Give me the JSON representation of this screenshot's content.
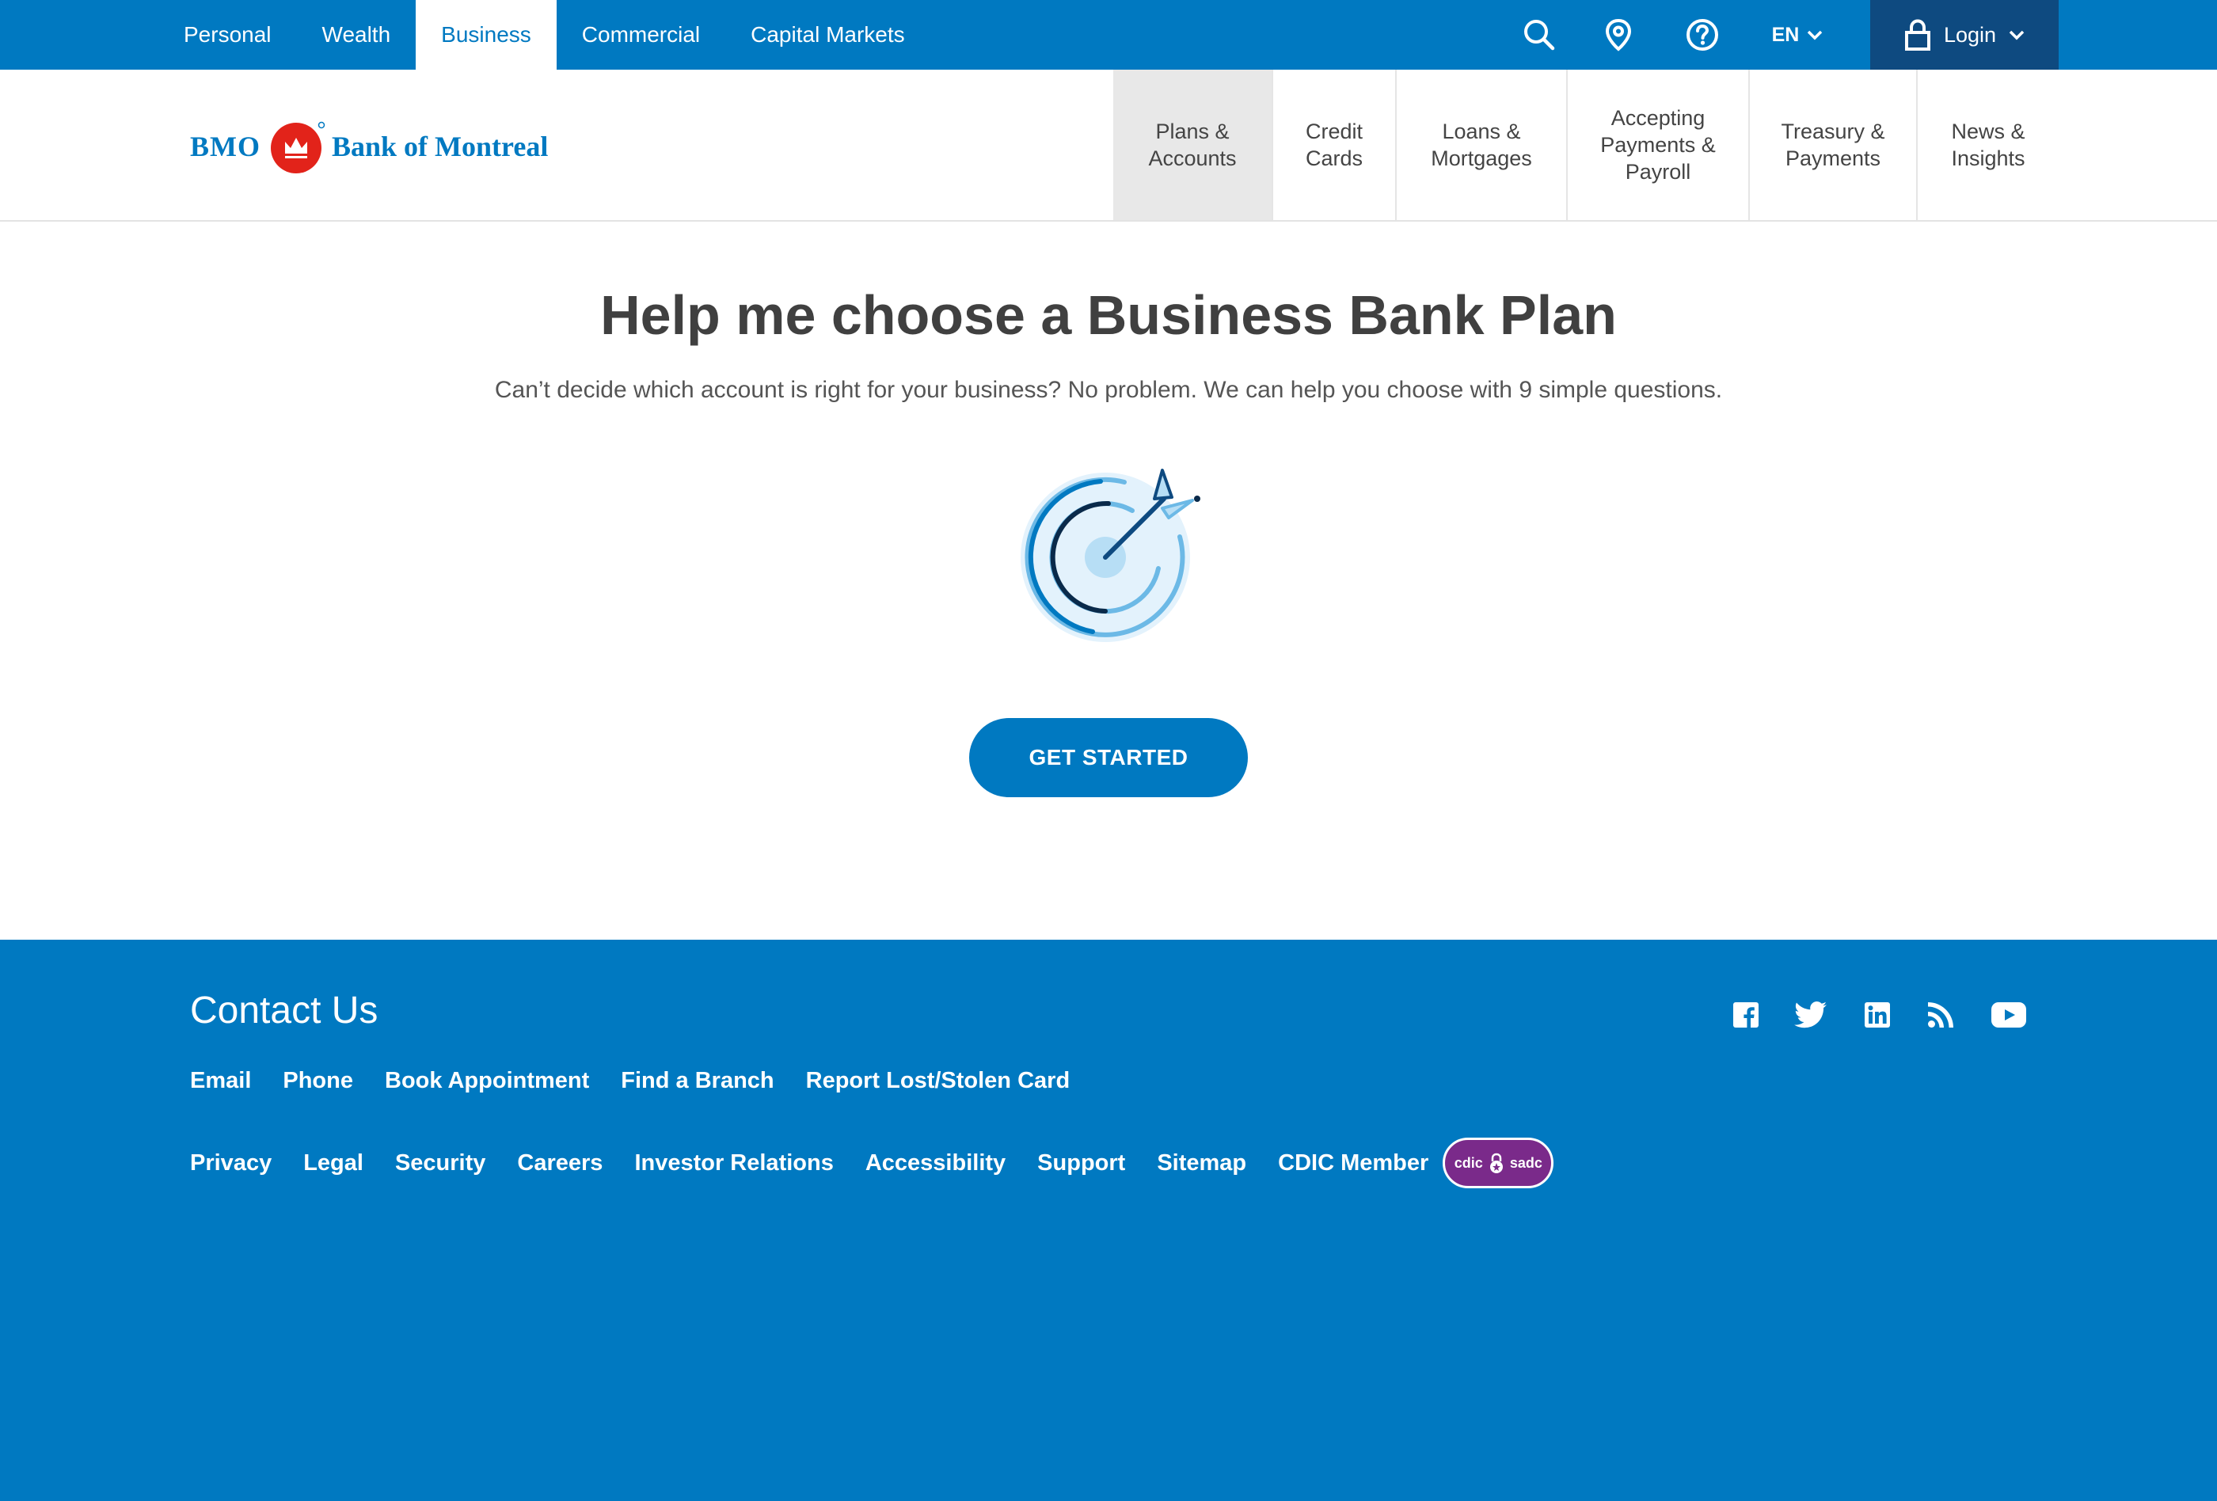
{
  "top_nav": {
    "items": [
      {
        "label": "Personal"
      },
      {
        "label": "Wealth"
      },
      {
        "label": "Business"
      },
      {
        "label": "Commercial"
      },
      {
        "label": "Capital Markets"
      }
    ],
    "active": "Business",
    "language": "EN",
    "login_label": "Login"
  },
  "header": {
    "logo_bmo": "BMO",
    "logo_name": "Bank of Montreal",
    "main_nav": [
      {
        "label": "Plans &\nAccounts"
      },
      {
        "label": "Credit\nCards"
      },
      {
        "label": "Loans &\nMortgages"
      },
      {
        "label": "Accepting\nPayments &\nPayroll"
      },
      {
        "label": "Treasury &\nPayments"
      },
      {
        "label": "News &\nInsights"
      }
    ],
    "active": "Plans & Accounts"
  },
  "hero": {
    "title": "Help me choose a Business Bank Plan",
    "subtitle": "Can’t decide which account is right for your business? No problem. We can help you choose with 9 simple questions.",
    "cta_label": "GET STARTED"
  },
  "footer": {
    "contact_title": "Contact Us",
    "contact_links": [
      {
        "label": "Email"
      },
      {
        "label": "Phone"
      },
      {
        "label": "Book Appointment"
      },
      {
        "label": "Find a Branch"
      },
      {
        "label": "Report Lost/Stolen Card"
      }
    ],
    "legal_links": [
      {
        "label": "Privacy"
      },
      {
        "label": "Legal"
      },
      {
        "label": "Security"
      },
      {
        "label": "Careers"
      },
      {
        "label": "Investor Relations"
      },
      {
        "label": "Accessibility"
      },
      {
        "label": "Support"
      },
      {
        "label": "Sitemap"
      },
      {
        "label": "CDIC Member"
      }
    ],
    "cdic_badge": {
      "left": "cdic",
      "right": "sadc"
    },
    "social_icons": [
      "facebook-icon",
      "twitter-icon",
      "linkedin-icon",
      "rss-icon",
      "youtube-icon"
    ]
  },
  "colors": {
    "brand_blue": "#0079c1",
    "login_bg": "#0e4a80",
    "logo_red": "#e2231a",
    "cdic_purple": "#7a2a8a"
  }
}
